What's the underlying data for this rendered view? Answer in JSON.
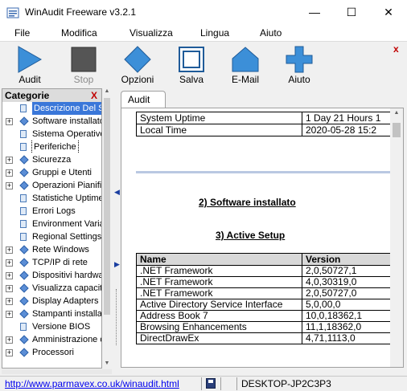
{
  "window": {
    "title": "WinAudit Freeware v3.2.1",
    "min_glyph": "—",
    "max_glyph": "☐",
    "close_glyph": "✕"
  },
  "menu": [
    "File",
    "Modifica",
    "Visualizza",
    "Lingua",
    "Aiuto"
  ],
  "toolbar": {
    "buttons": [
      {
        "label": "Audit",
        "icon": "play-icon",
        "enabled": true
      },
      {
        "label": "Stop",
        "icon": "stop-icon",
        "enabled": false
      },
      {
        "label": "Opzioni",
        "icon": "diamond-icon",
        "enabled": true
      },
      {
        "label": "Salva",
        "icon": "save-icon",
        "enabled": true
      },
      {
        "label": "E-Mail",
        "icon": "house-icon",
        "enabled": true
      },
      {
        "label": "Aiuto",
        "icon": "plus-icon",
        "enabled": true
      }
    ],
    "close_glyph": "x"
  },
  "sidebar": {
    "title": "Categorie",
    "close_glyph": "X",
    "items": [
      {
        "label": "Descrizione Del Sis",
        "icon": "doc",
        "expander": "",
        "state": "selected"
      },
      {
        "label": "Software installato",
        "icon": "diamond",
        "expander": "+",
        "state": ""
      },
      {
        "label": "Sistema Operativo",
        "icon": "doc",
        "expander": "",
        "state": ""
      },
      {
        "label": "Periferiche",
        "icon": "doc",
        "expander": "",
        "state": "focus"
      },
      {
        "label": "Sicurezza",
        "icon": "diamond",
        "expander": "+",
        "state": ""
      },
      {
        "label": "Gruppi e Utenti",
        "icon": "diamond",
        "expander": "+",
        "state": ""
      },
      {
        "label": "Operazioni Pianific",
        "icon": "diamond",
        "expander": "+",
        "state": ""
      },
      {
        "label": "Statistiche Uptime",
        "icon": "doc",
        "expander": "",
        "state": ""
      },
      {
        "label": "Errori Logs",
        "icon": "doc",
        "expander": "",
        "state": ""
      },
      {
        "label": "Environment Variab",
        "icon": "doc",
        "expander": "",
        "state": ""
      },
      {
        "label": "Regional Settings",
        "icon": "doc",
        "expander": "",
        "state": ""
      },
      {
        "label": "Rete Windows",
        "icon": "diamond",
        "expander": "+",
        "state": ""
      },
      {
        "label": "TCP/IP di rete",
        "icon": "diamond",
        "expander": "+",
        "state": ""
      },
      {
        "label": "Dispositivi hardwar",
        "icon": "diamond",
        "expander": "+",
        "state": ""
      },
      {
        "label": "Visualizza capacit",
        "icon": "diamond",
        "expander": "+",
        "state": ""
      },
      {
        "label": "Display Adapters",
        "icon": "diamond",
        "expander": "+",
        "state": ""
      },
      {
        "label": "Stampanti installa",
        "icon": "diamond",
        "expander": "+",
        "state": ""
      },
      {
        "label": "Versione BIOS",
        "icon": "doc",
        "expander": "",
        "state": ""
      },
      {
        "label": "Amministrazione d",
        "icon": "diamond",
        "expander": "+",
        "state": ""
      },
      {
        "label": "Processori",
        "icon": "diamond",
        "expander": "+",
        "state": ""
      }
    ]
  },
  "tab": {
    "label": "Audit"
  },
  "report": {
    "summary_rows": [
      {
        "key": "System Uptime",
        "value": "1 Day 21 Hours 1"
      },
      {
        "key": "Local Time",
        "value": "2020-05-28 15:2"
      }
    ],
    "section_software": "2) Software installato",
    "section_active_setup": "3) Active Setup",
    "columns": [
      "Name",
      "Version"
    ],
    "rows": [
      {
        "name": ".NET Framework",
        "version": "2,0,50727,1"
      },
      {
        "name": ".NET Framework",
        "version": "4,0,30319,0"
      },
      {
        "name": ".NET Framework",
        "version": "2,0,50727,0"
      },
      {
        "name": "Active Directory Service Interface",
        "version": "5,0,00,0"
      },
      {
        "name": "Address Book 7",
        "version": "10,0,18362,1"
      },
      {
        "name": "Browsing Enhancements",
        "version": "11,1,18362,0"
      },
      {
        "name": "DirectDrawEx",
        "version": "4,71,1113,0"
      }
    ]
  },
  "status": {
    "link": "http://www.parmavex.co.uk/winaudit.html",
    "computer": "DESKTOP-JP2C3P3"
  }
}
